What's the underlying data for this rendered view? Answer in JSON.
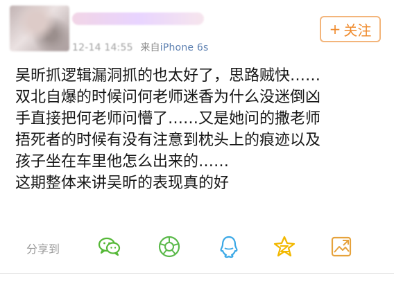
{
  "post": {
    "meta": {
      "time": "12-14 14:55",
      "source_prefix": "来自",
      "device": "iPhone 6s"
    },
    "follow_button": {
      "plus": "+",
      "label": "关注"
    },
    "content_lines": [
      "吴昕抓逻辑漏洞抓的也太好了，思路贼快……",
      "双北自爆的时候问何老师迷香为什么没迷倒凶",
      "手直接把何老师问懵了……又是她问的撒老师",
      "捂死者的时候有没有注意到枕头上的痕迹以及",
      "孩子坐在车里他怎么出来的……",
      "这期整体来讲吴昕的表现真的好"
    ]
  },
  "share": {
    "label": "分享到",
    "icons": [
      "wechat-icon",
      "moments-icon",
      "qq-icon",
      "qzone-icon",
      "image-share-icon"
    ],
    "colors": {
      "wechat": "#55b837",
      "moments": "#5ab94a",
      "qq": "#3aa8e6",
      "qzone": "#f2b800",
      "image": "#e6a23c"
    }
  },
  "colors": {
    "accent": "#ef8a2c",
    "follow_border": "#f3b57b",
    "device_text": "#5b7fb0",
    "meta_text": "#8a8a8a"
  }
}
